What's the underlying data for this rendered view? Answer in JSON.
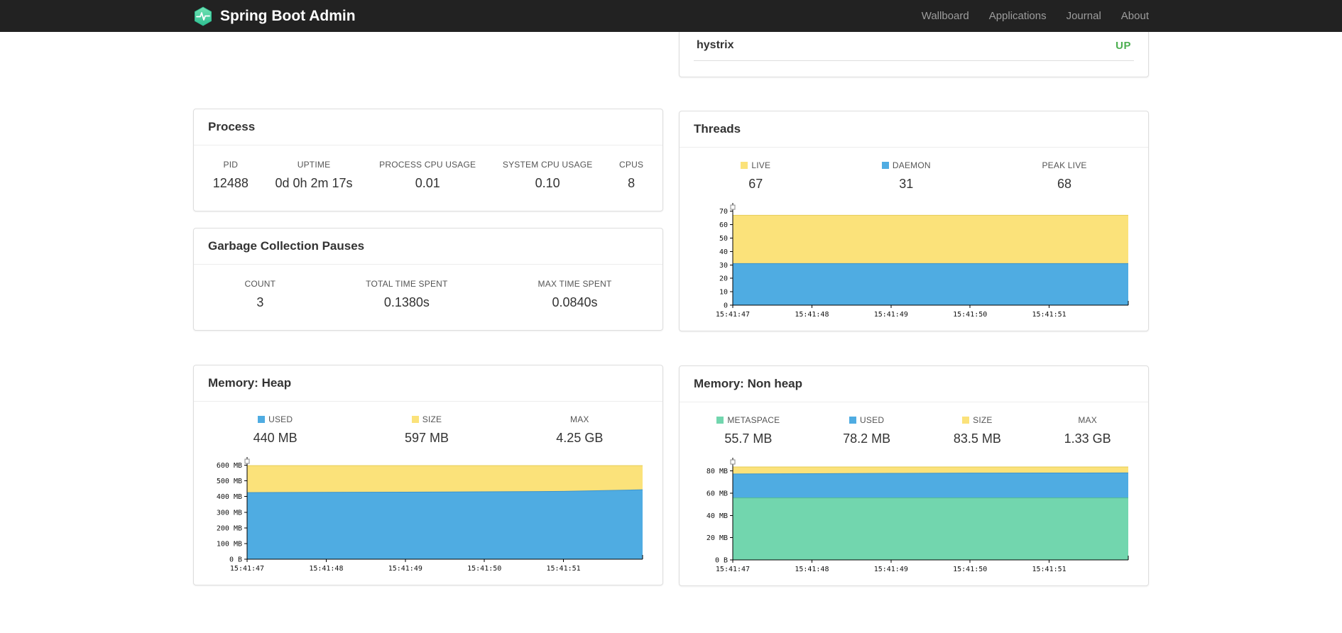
{
  "navbar": {
    "brand": "Spring Boot Admin",
    "links": [
      {
        "label": "Wallboard"
      },
      {
        "label": "Applications"
      },
      {
        "label": "Journal"
      },
      {
        "label": "About"
      }
    ]
  },
  "health_card": {
    "rows": [
      {
        "name": "hystrix",
        "status": "UP"
      }
    ]
  },
  "process": {
    "title": "Process",
    "stats": [
      {
        "label": "PID",
        "value": "12488"
      },
      {
        "label": "UPTIME",
        "value": "0d 0h 2m 17s"
      },
      {
        "label": "PROCESS CPU USAGE",
        "value": "0.01"
      },
      {
        "label": "SYSTEM CPU USAGE",
        "value": "0.10"
      },
      {
        "label": "CPUS",
        "value": "8"
      }
    ]
  },
  "gc": {
    "title": "Garbage Collection Pauses",
    "stats": [
      {
        "label": "COUNT",
        "value": "3"
      },
      {
        "label": "TOTAL TIME SPENT",
        "value": "0.1380s"
      },
      {
        "label": "MAX TIME SPENT",
        "value": "0.0840s"
      }
    ]
  },
  "threads": {
    "title": "Threads",
    "stats": [
      {
        "label": "LIVE",
        "value": "67",
        "swatch": "yellow"
      },
      {
        "label": "DAEMON",
        "value": "31",
        "swatch": "blue"
      },
      {
        "label": "PEAK LIVE",
        "value": "68"
      }
    ]
  },
  "heap": {
    "title": "Memory: Heap",
    "stats": [
      {
        "label": "USED",
        "value": "440 MB",
        "swatch": "blue"
      },
      {
        "label": "SIZE",
        "value": "597 MB",
        "swatch": "yellow"
      },
      {
        "label": "MAX",
        "value": "4.25 GB"
      }
    ]
  },
  "nonheap": {
    "title": "Memory: Non heap",
    "stats": [
      {
        "label": "METASPACE",
        "value": "55.7 MB",
        "swatch": "green"
      },
      {
        "label": "USED",
        "value": "78.2 MB",
        "swatch": "blue"
      },
      {
        "label": "SIZE",
        "value": "83.5 MB",
        "swatch": "yellow"
      },
      {
        "label": "MAX",
        "value": "1.33 GB"
      }
    ]
  },
  "chart_data": [
    {
      "id": "threads",
      "type": "area",
      "title": "Threads",
      "x_labels": [
        "15:41:47",
        "15:41:48",
        "15:41:49",
        "15:41:50",
        "15:41:51"
      ],
      "points": 6,
      "ymax": 73,
      "ylim": [
        0,
        70
      ],
      "grid": false,
      "y_ticks": [
        {
          "label": "0",
          "value": 0
        },
        {
          "label": "10",
          "value": 10
        },
        {
          "label": "20",
          "value": 20
        },
        {
          "label": "30",
          "value": 30
        },
        {
          "label": "40",
          "value": 40
        },
        {
          "label": "50",
          "value": 50
        },
        {
          "label": "60",
          "value": 60
        },
        {
          "label": "70",
          "value": 70
        }
      ],
      "series": [
        {
          "name": "LIVE",
          "color": "yellow",
          "values": [
            67,
            67,
            67,
            67,
            67,
            67
          ]
        },
        {
          "name": "DAEMON",
          "color": "blue",
          "values": [
            31,
            31,
            31,
            31,
            31,
            31
          ]
        }
      ]
    },
    {
      "id": "memory-heap",
      "type": "area",
      "title": "Memory: Heap",
      "x_labels": [
        "15:41:47",
        "15:41:48",
        "15:41:49",
        "15:41:50",
        "15:41:51"
      ],
      "points": 6,
      "ymax": 625,
      "ylim": [
        0,
        600
      ],
      "grid": false,
      "y_ticks": [
        {
          "label": "0 B",
          "value": 0
        },
        {
          "label": "100 MB",
          "value": 100
        },
        {
          "label": "200 MB",
          "value": 200
        },
        {
          "label": "300 MB",
          "value": 300
        },
        {
          "label": "400 MB",
          "value": 400
        },
        {
          "label": "500 MB",
          "value": 500
        },
        {
          "label": "600 MB",
          "value": 600
        }
      ],
      "series": [
        {
          "name": "SIZE",
          "color": "yellow",
          "values": [
            597,
            597,
            597,
            597,
            597,
            597
          ]
        },
        {
          "name": "USED",
          "color": "blue",
          "values": [
            425,
            427,
            428,
            430,
            433,
            443
          ]
        }
      ]
    },
    {
      "id": "memory-nonheap",
      "type": "area",
      "title": "Memory: Non heap",
      "x_labels": [
        "15:41:47",
        "15:41:48",
        "15:41:49",
        "15:41:50",
        "15:41:51"
      ],
      "points": 6,
      "ymax": 88,
      "ylim": [
        0,
        80
      ],
      "grid": false,
      "y_ticks": [
        {
          "label": "0 B",
          "value": 0
        },
        {
          "label": "20 MB",
          "value": 20
        },
        {
          "label": "40 MB",
          "value": 40
        },
        {
          "label": "60 MB",
          "value": 60
        },
        {
          "label": "80 MB",
          "value": 80
        }
      ],
      "series": [
        {
          "name": "SIZE",
          "color": "yellow",
          "values": [
            83.5,
            83.5,
            83.5,
            83.5,
            83.5,
            83.5
          ]
        },
        {
          "name": "USED",
          "color": "blue",
          "values": [
            77.2,
            77.5,
            77.8,
            78.0,
            78.1,
            78.2
          ]
        },
        {
          "name": "METASPACE",
          "color": "green",
          "values": [
            55.7,
            55.7,
            55.7,
            55.7,
            55.7,
            55.7
          ]
        }
      ]
    }
  ],
  "colors": {
    "blue": "#4FACE2",
    "blue_edge": "#3D94CC",
    "yellow": "#FBE27A",
    "yellow_edge": "#E6CC55",
    "green": "#72D6AE",
    "green_edge": "#55BD92",
    "up_green": "#4CAF50",
    "navbar_bg": "#222222",
    "brand_green": "#42D3A2"
  }
}
